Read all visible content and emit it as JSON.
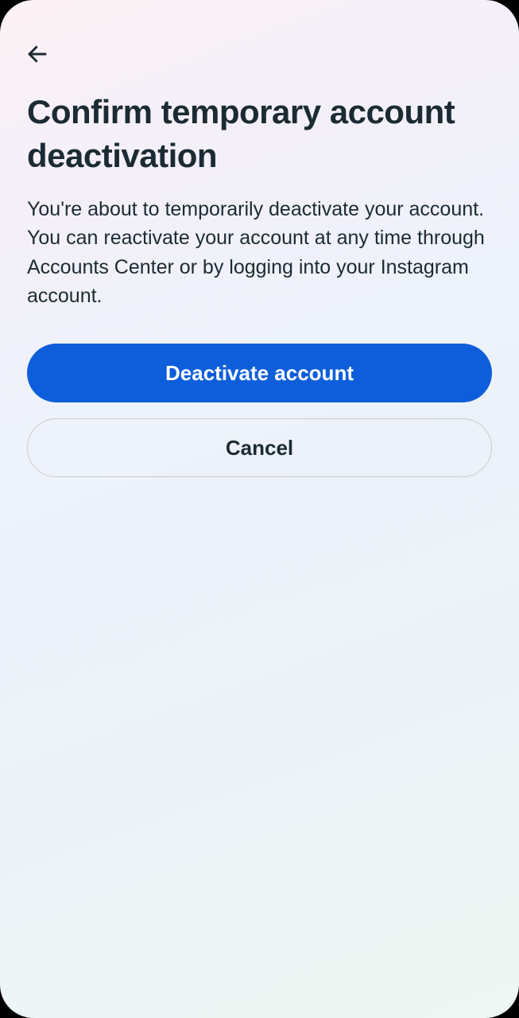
{
  "page": {
    "title": "Confirm temporary account deactivation",
    "description": "You're about to temporarily deactivate your account. You can reactivate your account at any time through Accounts Center or by logging into your Instagram account."
  },
  "actions": {
    "primary_label": "Deactivate account",
    "secondary_label": "Cancel"
  }
}
